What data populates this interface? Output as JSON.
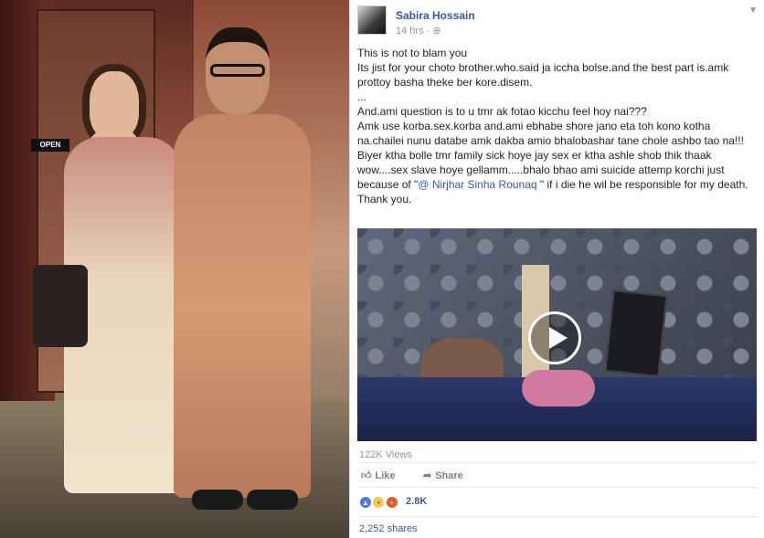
{
  "post": {
    "author": "Sabira Hossain",
    "time": "14 hrs",
    "privacy_glyph": "·",
    "lines": [
      "This is not to blam you",
      "Its jist for your choto brother.who.said ja iccha bolse.and the best part is.amk prottoy basha theke ber kore.disem.",
      "...",
      "And.ami question is to u tmr ak fotao kicchu feel hoy nai???",
      "Amk use korba.sex.korba and.ami ebhabe shore jano eta toh kono kotha na.chailei nunu databe amk dakba amio bhalobashar tane chole ashbo tao na!!! Biyer ktha bolle tmr family sick hoye jay sex er ktha ashle shob thik thaak wow....sex slave hoye gellamm.....bhalo bhao ami suicide attemp korchi just because of \""
    ],
    "mention": "@ Nirjhar Sinha Rounaq",
    "after_mention": " \" if i die he wil be responsible for my death.",
    "closing": "Thank you."
  },
  "photo": {
    "open_sign": "OPEN"
  },
  "video": {
    "views": "122K Views"
  },
  "actions": {
    "like_label": "Like",
    "share_label": "Share"
  },
  "reactions": {
    "count": "2.8K"
  },
  "shares": "2,252 shares",
  "icons": {
    "like": "thumbs-up-icon",
    "share": "share-arrow-icon",
    "play": "play-icon",
    "chevron": "chevron-down-icon"
  }
}
